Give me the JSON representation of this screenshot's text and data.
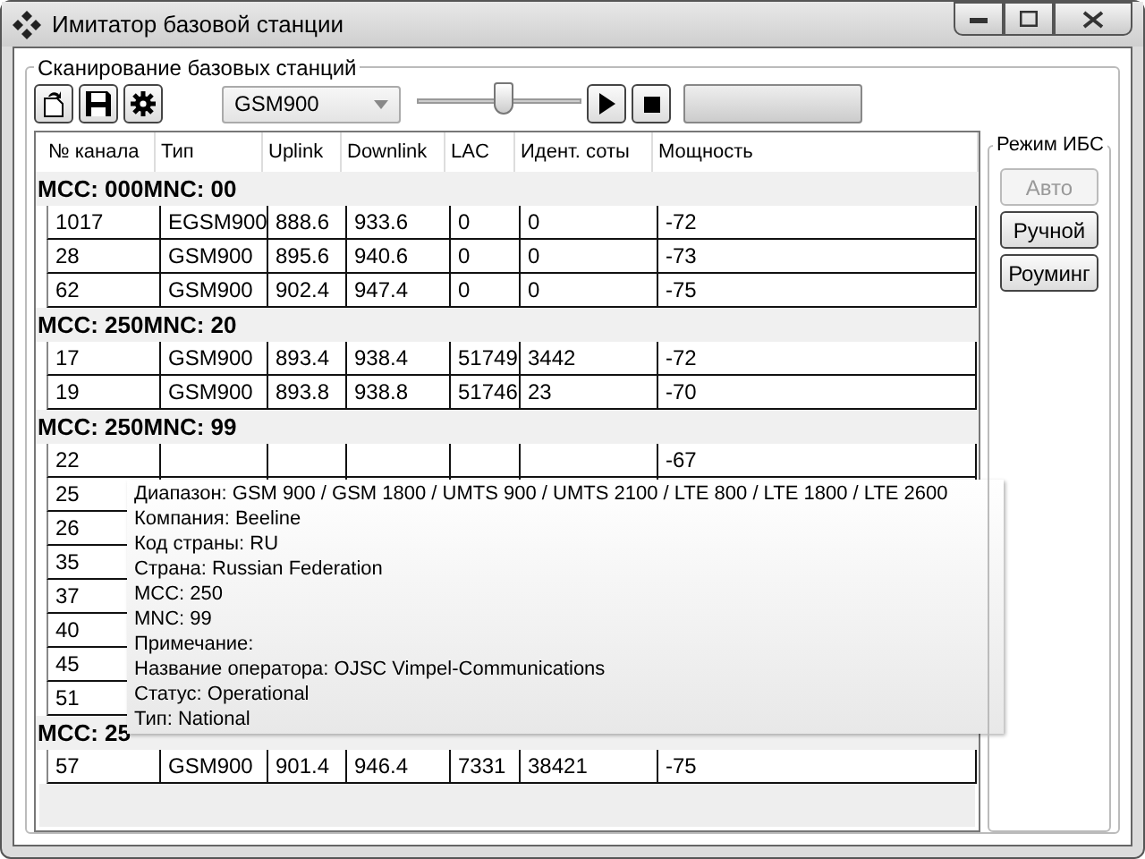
{
  "window": {
    "title": "Имитатор базовой станции"
  },
  "scan_group": {
    "title": "Сканирование базовых станций"
  },
  "band_select": {
    "value": "GSM900"
  },
  "slider": {
    "level": 0.52
  },
  "progress": {
    "level": 0
  },
  "table": {
    "columns": [
      "№ канала",
      "Тип",
      "Uplink",
      "Downlink",
      "LAC",
      "Идент. соты",
      "Мощность"
    ],
    "groups": [
      {
        "title": "MCC: 000MNC: 00",
        "rows": [
          {
            "channel": "1017",
            "type": "EGSM900",
            "uplink": "888.6",
            "downlink": "933.6",
            "lac": "0",
            "cell_id": "0",
            "power": "-72"
          },
          {
            "channel": "28",
            "type": "GSM900",
            "uplink": "895.6",
            "downlink": "940.6",
            "lac": "0",
            "cell_id": "0",
            "power": "-73"
          },
          {
            "channel": "62",
            "type": "GSM900",
            "uplink": "902.4",
            "downlink": "947.4",
            "lac": "0",
            "cell_id": "0",
            "power": "-75"
          }
        ]
      },
      {
        "title": "MCC: 250MNC: 20",
        "rows": [
          {
            "channel": "17",
            "type": "GSM900",
            "uplink": "893.4",
            "downlink": "938.4",
            "lac": "51749",
            "cell_id": "3442",
            "power": "-72"
          },
          {
            "channel": "19",
            "type": "GSM900",
            "uplink": "893.8",
            "downlink": "938.8",
            "lac": "51746",
            "cell_id": "23",
            "power": "-70"
          }
        ]
      },
      {
        "title": "MCC: 250MNC: 99",
        "rows": [
          {
            "channel": "22",
            "power": "-67"
          },
          {
            "channel": "25"
          },
          {
            "channel": "26"
          },
          {
            "channel": "35"
          },
          {
            "channel": "37"
          },
          {
            "channel": "40"
          },
          {
            "channel": "45"
          },
          {
            "channel": "51"
          }
        ]
      },
      {
        "title": "MCC: 25",
        "rows": [
          {
            "channel": "57",
            "type": "GSM900",
            "uplink": "901.4",
            "downlink": "946.4",
            "lac": "7331",
            "cell_id": "38421",
            "power": "-75"
          }
        ]
      }
    ]
  },
  "mode_panel": {
    "title": "Режим ИБС",
    "buttons": [
      {
        "label": "Авто",
        "disabled": true
      },
      {
        "label": "Ручной",
        "disabled": false
      },
      {
        "label": "Роуминг",
        "disabled": false
      }
    ]
  },
  "tooltip": {
    "lines": [
      "Диапазон: GSM 900 / GSM 1800 / UMTS 900 / UMTS 2100 / LTE 800 / LTE 1800 / LTE 2600",
      "Компания: Beeline",
      "Код страны: RU",
      "Страна: Russian Federation",
      "MCC: 250",
      "MNC: 99",
      "Примечание:",
      "Название оператора: OJSC Vimpel-Communications",
      "Статус: Operational",
      "Тип: National"
    ]
  }
}
